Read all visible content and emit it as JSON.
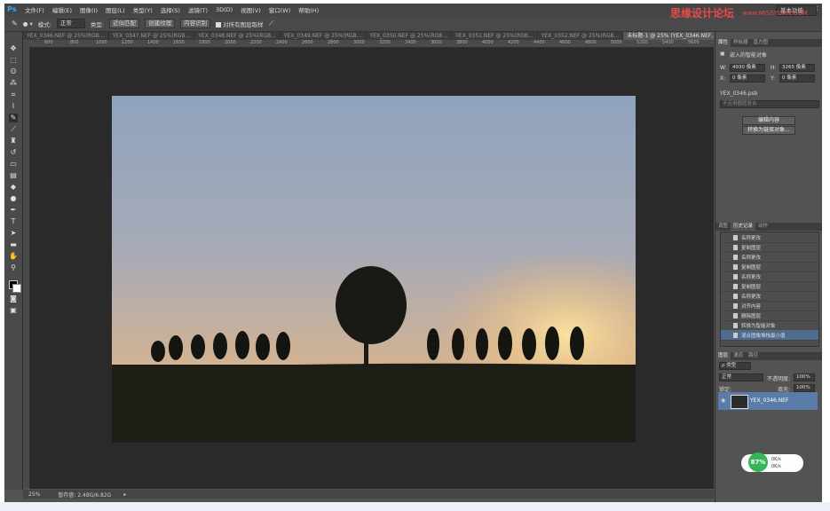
{
  "app": {
    "logo": "Ps"
  },
  "watermark": {
    "main": "思缘设计论坛",
    "sub": "www.MISSYUAN.COM"
  },
  "menu": [
    "文件(F)",
    "编辑(E)",
    "图像(I)",
    "图层(L)",
    "类型(Y)",
    "选择(S)",
    "滤镜(T)",
    "3D(D)",
    "视图(V)",
    "窗口(W)",
    "帮助(H)"
  ],
  "window_controls": [
    "–",
    "□",
    "×"
  ],
  "options": {
    "mode_label": "模式:",
    "mode_value": "正常",
    "type_label": "类型:",
    "btn_proximity": "近似匹配",
    "btn_texture": "创建纹理",
    "btn_content": "内容识别",
    "sample_all": "对所有图层取样",
    "workspace": "基本功能"
  },
  "tabs": [
    "YEX_0346.NEF @ 25%(RGB...",
    "YEX_0347.NEF @ 25%(RGB...",
    "YEX_0348.NEF @ 25%(RGB...",
    "YEX_0349.NEF @ 25%(RGB...",
    "YEX_0350.NEF @ 25%(RGB...",
    "YEX_0351.NEF @ 25%(RGB...",
    "YEX_0352.NEF @ 25%(RGB...",
    "未标题-1 @ 25% (YEX_0346.NEF, RGB/8*) ×"
  ],
  "ruler": [
    "600",
    "800",
    "1000",
    "1200",
    "1400",
    "1600",
    "1800",
    "2000",
    "2200",
    "2400",
    "2600",
    "2800",
    "3000",
    "3200",
    "3400",
    "3600",
    "3800",
    "4000",
    "4200",
    "4400",
    "4600",
    "4800",
    "5000",
    "5200",
    "5400",
    "5600"
  ],
  "status": {
    "zoom": "25%",
    "doc": "暂存盘: 2.48G/6.82G"
  },
  "properties": {
    "tabs": [
      "属性",
      "样板器",
      "直方图"
    ],
    "title": "嵌入的智能对象",
    "w_label": "W:",
    "w_value": "4930 像素",
    "h_label": "H:",
    "h_value": "3265 像素",
    "x_label": "X:",
    "x_value": "0 像素",
    "y_label": "Y:",
    "y_value": "0 像素",
    "filename": "YEX_0346.psb",
    "comp_placeholder": "不应用图层复合",
    "btn_edit": "编辑内容",
    "btn_convert": "转换为链接对象..."
  },
  "history": {
    "tabs": [
      "调整",
      "历史记录",
      "动作"
    ],
    "items": [
      "名称更改",
      "复制图层",
      "名称更改",
      "复制图层",
      "名称更改",
      "复制图层",
      "名称更改",
      "对齐内容",
      "删除图层",
      "转换为智能对象",
      "混合图像堆栈最小值"
    ]
  },
  "layers": {
    "tabs": [
      "图层",
      "通道",
      "路径"
    ],
    "filter": "ρ 类型",
    "blend": "正常",
    "opacity_label": "不透明度:",
    "opacity": "100%",
    "lock_label": "锁定:",
    "fill_label": "填充:",
    "fill": "100%",
    "layer_name": "YEX_0346.NEF"
  },
  "perf": {
    "percent": "87%",
    "up": "0K/s",
    "down": "0K/s"
  },
  "icon_names": [
    "move-icon",
    "marquee-icon",
    "lasso-icon",
    "quick-select-icon",
    "crop-icon",
    "eyedropper-icon",
    "healing-brush-icon",
    "brush-icon",
    "clone-stamp-icon",
    "history-brush-icon",
    "eraser-icon",
    "gradient-icon",
    "blur-icon",
    "dodge-icon",
    "pen-icon",
    "type-icon",
    "path-select-icon",
    "rectangle-icon",
    "hand-icon",
    "zoom-icon"
  ]
}
